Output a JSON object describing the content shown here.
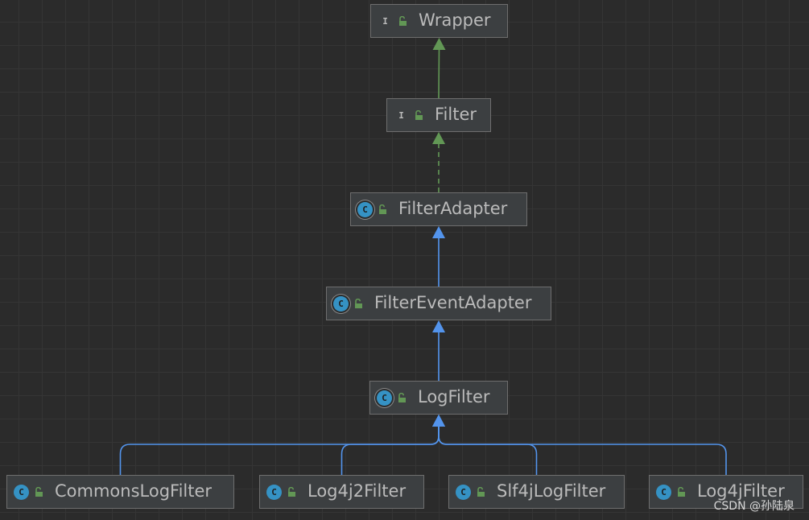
{
  "nodes": [
    {
      "id": "wrapper",
      "label": "Wrapper",
      "kind": "interface",
      "kind_letter": "I"
    },
    {
      "id": "filter",
      "label": "Filter",
      "kind": "interface",
      "kind_letter": "I"
    },
    {
      "id": "filteradapter",
      "label": "FilterAdapter",
      "kind": "abstract",
      "kind_letter": "C"
    },
    {
      "id": "filtereventadapter",
      "label": "FilterEventAdapter",
      "kind": "abstract",
      "kind_letter": "C"
    },
    {
      "id": "logfilter",
      "label": "LogFilter",
      "kind": "abstract",
      "kind_letter": "C"
    },
    {
      "id": "commonslogfilter",
      "label": "CommonsLogFilter",
      "kind": "class",
      "kind_letter": "C"
    },
    {
      "id": "log4j2filter",
      "label": "Log4j2Filter",
      "kind": "class",
      "kind_letter": "C"
    },
    {
      "id": "slf4jlogfilter",
      "label": "Slf4jLogFilter",
      "kind": "class",
      "kind_letter": "C"
    },
    {
      "id": "log4jfilter",
      "label": "Log4jFilter",
      "kind": "class",
      "kind_letter": "C"
    }
  ],
  "edges": [
    {
      "from": "filter",
      "to": "wrapper",
      "type": "extends"
    },
    {
      "from": "filteradapter",
      "to": "filter",
      "type": "implements"
    },
    {
      "from": "filtereventadapter",
      "to": "filteradapter",
      "type": "extends"
    },
    {
      "from": "logfilter",
      "to": "filtereventadapter",
      "type": "extends"
    },
    {
      "from": "commonslogfilter",
      "to": "logfilter",
      "type": "extends"
    },
    {
      "from": "log4j2filter",
      "to": "logfilter",
      "type": "extends"
    },
    {
      "from": "slf4jlogfilter",
      "to": "logfilter",
      "type": "extends"
    },
    {
      "from": "log4jfilter",
      "to": "logfilter",
      "type": "extends"
    }
  ],
  "colors": {
    "background": "#2b2b2b",
    "grid": "#353535",
    "node_fill": "#3c3f41",
    "node_border": "#6e6e6e",
    "text": "#bbbbbb",
    "interface_icon": "#629755",
    "class_icon": "#3592c4",
    "lock_icon": "#629755",
    "interface_edge": "#629755",
    "class_edge": "#5394ec"
  },
  "icons": {
    "kind": "class-kind-icon",
    "visibility": "public-lock-icon"
  },
  "watermark": "CSDN @孙陆泉"
}
